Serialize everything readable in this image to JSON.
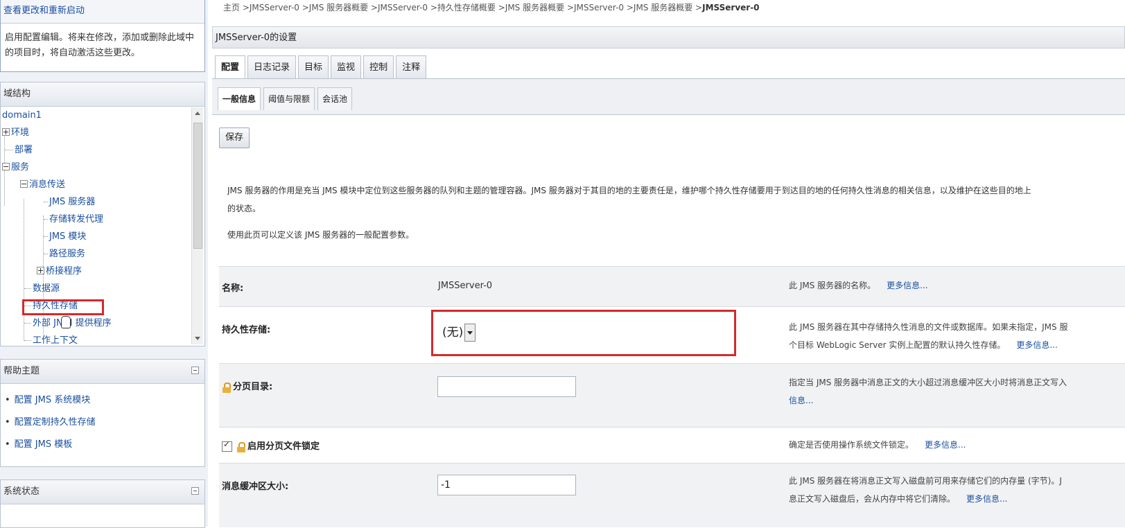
{
  "left": {
    "changes_panel": {
      "title": "查看更改和重新启动",
      "line1": "启用配置编辑。将来在修改，添加或删除此域中",
      "line2": "的项目时，将自动激活这些更改。"
    },
    "tree_panel": {
      "title": "域结构",
      "items": [
        {
          "label": "domain1"
        },
        {
          "label": "环境"
        },
        {
          "label": "部署"
        },
        {
          "label": "服务"
        },
        {
          "label": "消息传送"
        },
        {
          "label": "JMS 服务器"
        },
        {
          "label": "存储转发代理"
        },
        {
          "label": "JMS 模块"
        },
        {
          "label": "路径服务"
        },
        {
          "label": "桥接程序"
        },
        {
          "label": "数据源"
        },
        {
          "label": "持久性存储"
        },
        {
          "label": "外部 JNDI 提供程序"
        },
        {
          "label": "工作上下文"
        }
      ]
    },
    "help_panel": {
      "title": "帮助主题",
      "links": [
        "配置 JMS 系统模块",
        "配置定制持久性存储",
        "配置 JMS 模板"
      ]
    },
    "status_panel": {
      "title": "系统状态"
    }
  },
  "main": {
    "breadcrumb": "主页 >JMSServer-0 >JMS 服务器概要 >JMSServer-0 >持久性存储概要 >JMS 服务器概要 >JMSServer-0 >JMS 服务器概要 >",
    "breadcrumb_current": "JMSServer-0",
    "settings_title": "JMSServer-0的设置",
    "tabs": [
      "配置",
      "日志记录",
      "目标",
      "监视",
      "控制",
      "注释"
    ],
    "subtabs": [
      "一般信息",
      "阈值与限额",
      "会话池"
    ],
    "save_label": "保存",
    "description_line1": "JMS 服务器的作用是充当 JMS 模块中定位到这些服务器的队列和主题的管理容器。JMS 服务器对于其目的地的主要责任是，维护哪个持久性存储要用于到达目的地的任何持久性消息的相关信息，以及维护在这些目的地上",
    "description_line2": "的状态。",
    "description_2": "使用此页可以定义该 JMS 服务器的一般配置参数。",
    "fields": {
      "name": {
        "label": "名称:",
        "value": "JMSServer-0",
        "help": "此 JMS 服务器的名称。",
        "more": "更多信息..."
      },
      "store": {
        "label": "持久性存储:",
        "value": "(无)",
        "help1": "此 JMS 服务器在其中存储持久性消息的文件或数据库。如果未指定，JMS 服",
        "help2": "个目标 WebLogic Server 实例上配置的默认持久性存储。",
        "more": "更多信息..."
      },
      "paging_dir": {
        "label": "分页目录:",
        "value": "",
        "help1": "指定当 JMS 服务器中消息正文的大小超过消息缓冲区大小时将消息正文写入",
        "help2": "信息..."
      },
      "paging_lock": {
        "label": "启用分页文件锁定",
        "help": "确定是否使用操作系统文件锁定。",
        "more": "更多信息..."
      },
      "buffer_size": {
        "label": "消息缓冲区大小:",
        "value": "-1",
        "help1": "此 JMS 服务器在将消息正文写入磁盘前可用来存储它们的内存量 (字节)。J",
        "help2": "息正文写入磁盘后，会从内存中将它们清除。",
        "more": "更多信息..."
      }
    }
  }
}
